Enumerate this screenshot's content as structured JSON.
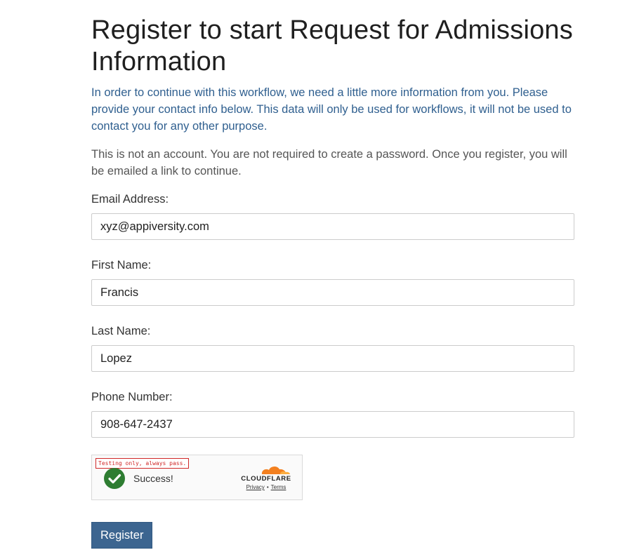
{
  "page": {
    "title": "Register to start Request for Admissions Information",
    "intro": "In order to continue with this workflow, we need a little more information from you. Please provide your contact info below. This data will only be used for workflows, it will not be used to contact you for any other purpose.",
    "note": "This is not an account. You are not required to create a password. Once you register, you will be emailed a link to continue."
  },
  "form": {
    "email": {
      "label": "Email Address:",
      "value": "xyz@appiversity.com"
    },
    "first_name": {
      "label": "First Name:",
      "value": "Francis"
    },
    "last_name": {
      "label": "Last Name:",
      "value": "Lopez"
    },
    "phone": {
      "label": "Phone Number:",
      "value": "908-647-2437"
    },
    "register_label": "Register"
  },
  "captcha": {
    "testing_note": "Testing only, always pass.",
    "status": "Success!",
    "brand": "CLOUDFLARE",
    "privacy_label": "Privacy",
    "separator": "•",
    "terms_label": "Terms",
    "check_color": "#2e7d32",
    "cloud_color": "#f38020"
  },
  "colors": {
    "intro_text": "#2f5f8f",
    "button_bg": "#3c6590"
  }
}
